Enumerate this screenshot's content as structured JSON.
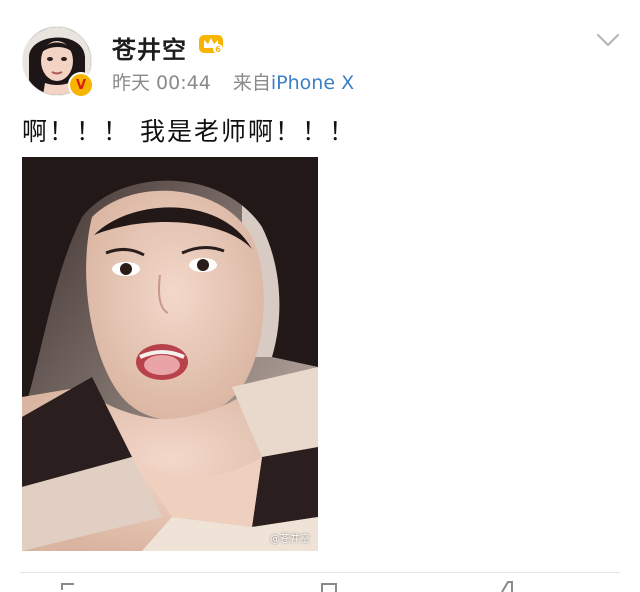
{
  "post": {
    "author_name": "苍井空",
    "time": "昨天 00:44",
    "source_prefix": "来自",
    "source_device": "iPhone X",
    "content": "啊！！！ 我是老师啊！！！",
    "image_watermark": "@苍井空",
    "verified_badge": "V",
    "crown_badge_icon": "crown-level-6-icon",
    "accent_color": "#f7b500",
    "source_color": "#3b7fc4"
  }
}
